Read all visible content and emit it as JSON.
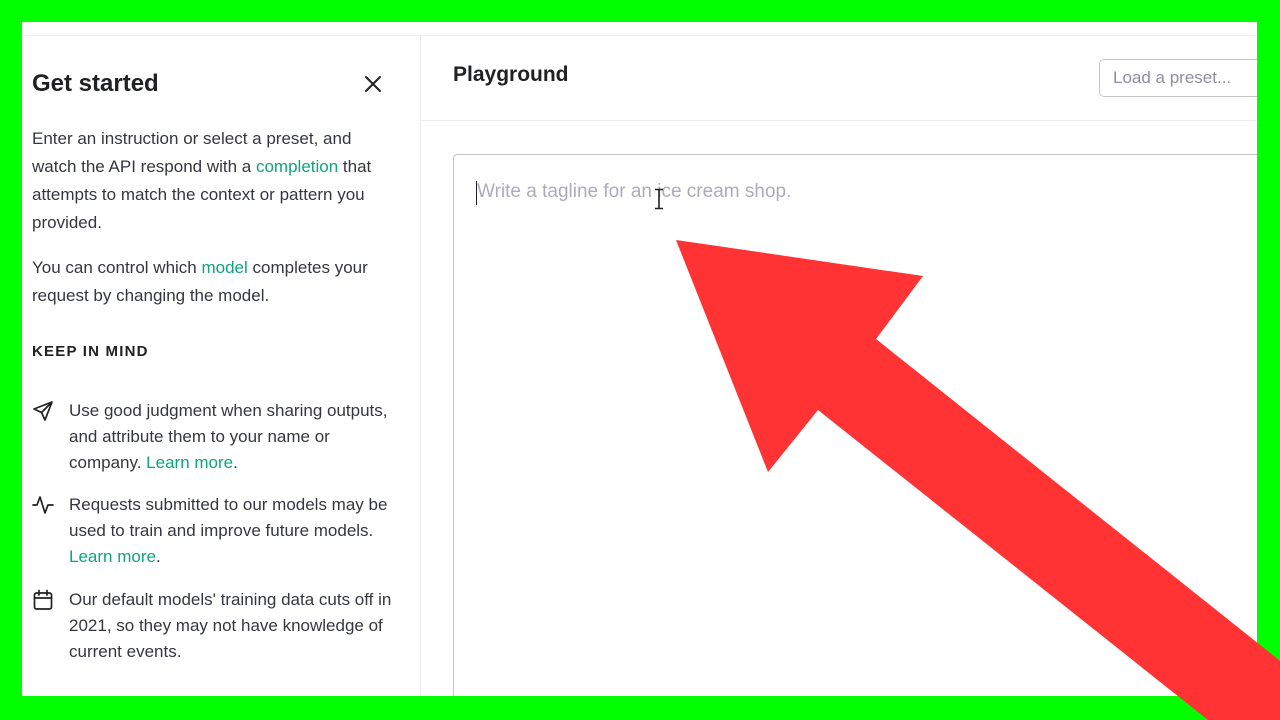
{
  "sidebar": {
    "title": "Get started",
    "intro": {
      "before_link": "Enter an instruction or select a preset, and watch the API respond with a ",
      "link": "completion",
      "after_link": " that attempts to match the context or pattern you provided."
    },
    "model_note": {
      "before_link": "You can control which ",
      "link": "model",
      "after_link": " completes your request by changing the model."
    },
    "keep_in_mind_heading": "KEEP IN MIND",
    "tips": [
      {
        "icon": "send-icon",
        "text": "Use good judgment when sharing outputs, and attribute them to your name or company. ",
        "link": "Learn more",
        "end": "."
      },
      {
        "icon": "activity-icon",
        "text": "Requests submitted to our models may be used to train and improve future models. ",
        "link": "Learn more",
        "end": "."
      },
      {
        "icon": "calendar-icon",
        "text": "Our default models' training data cuts off in 2021, so they may not have knowledge of current events.",
        "link": "",
        "end": ""
      }
    ]
  },
  "main": {
    "title": "Playground",
    "preset_placeholder": "Load a preset...",
    "editor_placeholder": "Write a tagline for an ice cream shop."
  },
  "colors": {
    "frame": "#00ff00",
    "link": "#10a37f",
    "arrow": "#ff3333"
  }
}
